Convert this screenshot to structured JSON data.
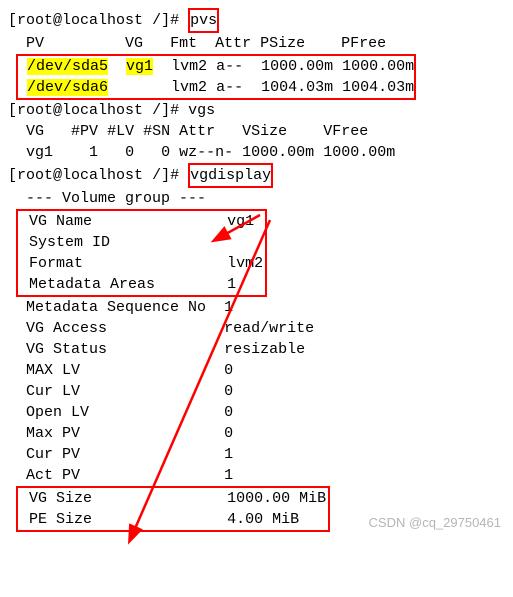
{
  "prompt": {
    "user": "root",
    "host": "localhost",
    "path": "/",
    "symbol": "#"
  },
  "cmd_pvs": "pvs",
  "pvs_header": {
    "pv": "PV",
    "vg": "VG",
    "fmt": "Fmt",
    "attr": "Attr",
    "psize": "PSize",
    "pfree": "PFree"
  },
  "pvs_rows": [
    {
      "pv": "/dev/sda5",
      "vg": "vg1",
      "fmt": "lvm2",
      "attr": "a--",
      "psize": "1000.00m",
      "pfree": "1000.00m"
    },
    {
      "pv": "/dev/sda6",
      "vg": "",
      "fmt": "lvm2",
      "attr": "a--",
      "psize": "1004.03m",
      "pfree": "1004.03m"
    }
  ],
  "cmd_vgs": "vgs",
  "vgs_header": {
    "vg": "VG",
    "npv": "#PV",
    "nlv": "#LV",
    "nsn": "#SN",
    "attr": "Attr",
    "vsize": "VSize",
    "vfree": "VFree"
  },
  "vgs_row": {
    "vg": "vg1",
    "npv": "1",
    "nlv": "0",
    "nsn": "0",
    "attr": "wz--n-",
    "vsize": "1000.00m",
    "vfree": "1000.00m"
  },
  "cmd_vgdisplay": "vgdisplay",
  "vgd": {
    "section": "--- Volume group ---",
    "vg_name_lbl": "VG Name",
    "vg_name_val": "vg1",
    "sysid_lbl": "System ID",
    "sysid_val": "",
    "format_lbl": "Format",
    "format_val": "lvm2",
    "meta_areas_lbl": "Metadata Areas",
    "meta_areas_val": "1",
    "meta_seq_lbl": "Metadata Sequence No",
    "meta_seq_val": "1",
    "access_lbl": "VG Access",
    "access_val": "read/write",
    "status_lbl": "VG Status",
    "status_val": "resizable",
    "maxlv_lbl": "MAX LV",
    "maxlv_val": "0",
    "curlv_lbl": "Cur LV",
    "curlv_val": "0",
    "openlv_lbl": "Open LV",
    "openlv_val": "0",
    "maxpv_lbl": "Max PV",
    "maxpv_val": "0",
    "curpv_lbl": "Cur PV",
    "curpv_val": "1",
    "actpv_lbl": "Act PV",
    "actpv_val": "1",
    "vgsize_lbl": "VG Size",
    "vgsize_val": "1000.00 MiB",
    "pesize_lbl": "PE Size",
    "pesize_val": "4.00 MiB"
  },
  "watermark": "CSDN @cq_29750461"
}
